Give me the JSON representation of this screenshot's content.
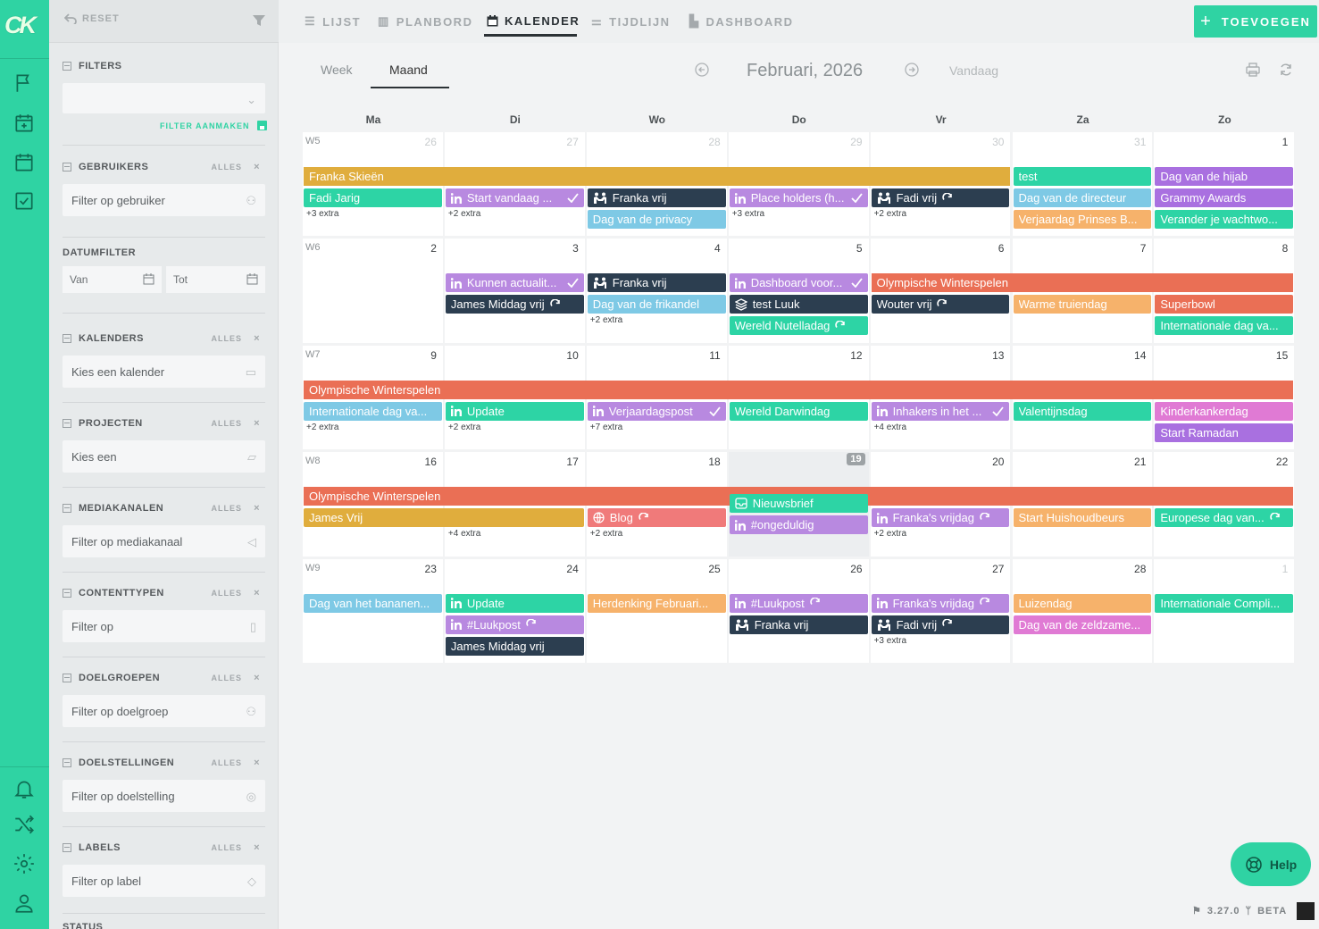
{
  "app": {
    "logo": "CK"
  },
  "sidebar": {
    "reset": "RESET",
    "filters": {
      "label": "FILTERS",
      "select_value": ""
    },
    "filter_aanmaken": "FILTER AANMAKEN",
    "gebruikers": {
      "label": "GEBRUIKERS",
      "alles": "ALLES",
      "placeholder": "Filter op gebruiker"
    },
    "datumfilter": {
      "label": "DATUMFILTER",
      "van": "Van",
      "tot": "Tot"
    },
    "kalenders": {
      "label": "KALENDERS",
      "alles": "ALLES",
      "placeholder": "Kies een kalender"
    },
    "projecten": {
      "label": "PROJECTEN",
      "alles": "ALLES",
      "placeholder": "Kies een"
    },
    "mediakanalen": {
      "label": "MEDIAKANALEN",
      "alles": "ALLES",
      "placeholder": "Filter op mediakanaal"
    },
    "contenttypen": {
      "label": "CONTENTTYPEN",
      "alles": "ALLES",
      "placeholder": "Filter op"
    },
    "doelgroepen": {
      "label": "DOELGROEPEN",
      "alles": "ALLES",
      "placeholder": "Filter op doelgroep"
    },
    "doelstellingen": {
      "label": "DOELSTELLINGEN",
      "alles": "ALLES",
      "placeholder": "Filter op doelstelling"
    },
    "labels": {
      "label": "LABELS",
      "alles": "ALLES",
      "placeholder": "Filter op label"
    },
    "status": {
      "label": "STATUS"
    }
  },
  "nav": {
    "lijst": "LIJST",
    "planbord": "PLANBORD",
    "kalender": "KALENDER",
    "tijdlijn": "TIJDLIJN",
    "dashboard": "DASHBOARD",
    "add": "TOEVOEGEN"
  },
  "calendar": {
    "tabs": {
      "week": "Week",
      "maand": "Maand"
    },
    "month": "Februari, 2026",
    "today": "Vandaag",
    "dows": [
      "Ma",
      "Di",
      "Wo",
      "Do",
      "Vr",
      "Za",
      "Zo"
    ],
    "weeks": [
      {
        "label": "W5",
        "days": [
          "26",
          "27",
          "28",
          "29",
          "30",
          "31",
          "1"
        ],
        "dim": [
          true,
          true,
          true,
          true,
          true,
          true,
          false
        ]
      },
      {
        "label": "W6",
        "days": [
          "2",
          "3",
          "4",
          "5",
          "6",
          "7",
          "8"
        ],
        "dim": [
          false,
          false,
          false,
          false,
          false,
          false,
          false
        ]
      },
      {
        "label": "W7",
        "days": [
          "9",
          "10",
          "11",
          "12",
          "13",
          "14",
          "15"
        ],
        "dim": [
          false,
          false,
          false,
          false,
          false,
          false,
          false
        ]
      },
      {
        "label": "W8",
        "days": [
          "16",
          "17",
          "18",
          "19",
          "20",
          "21",
          "22"
        ],
        "dim": [
          false,
          false,
          false,
          false,
          false,
          false,
          false
        ],
        "today": 3
      },
      {
        "label": "W9",
        "days": [
          "23",
          "24",
          "25",
          "26",
          "27",
          "28",
          "1"
        ],
        "dim": [
          false,
          false,
          false,
          false,
          false,
          false,
          true
        ]
      }
    ],
    "events": [
      {
        "w": 0,
        "d": 0,
        "span": 5,
        "row": 0,
        "title": "Franka Skieën",
        "color": "#e0ad3d"
      },
      {
        "w": 0,
        "d": 5,
        "span": 1,
        "row": 0,
        "title": "test",
        "color": "#2dd4a5"
      },
      {
        "w": 0,
        "d": 6,
        "span": 1,
        "row": 0,
        "title": "Dag van de hijab",
        "color": "#a970e0"
      },
      {
        "w": 0,
        "d": 0,
        "span": 1,
        "row": 1,
        "title": "Fadi Jarig",
        "color": "#2dd4a5"
      },
      {
        "w": 0,
        "d": 1,
        "span": 1,
        "row": 1,
        "title": "Start vandaag ...",
        "color": "#b889e0",
        "icon": "in",
        "status": "check"
      },
      {
        "w": 0,
        "d": 2,
        "span": 1,
        "row": 1,
        "title": "Franka vrij",
        "color": "#2c3e50",
        "icon": "people"
      },
      {
        "w": 0,
        "d": 3,
        "span": 1,
        "row": 1,
        "title": "Place holders (h...",
        "color": "#b889e0",
        "icon": "in",
        "status": "check"
      },
      {
        "w": 0,
        "d": 4,
        "span": 1,
        "row": 1,
        "title": "Fadi vrij",
        "color": "#2c3e50",
        "icon": "people",
        "status": "repeat"
      },
      {
        "w": 0,
        "d": 5,
        "span": 1,
        "row": 1,
        "title": "Dag van de directeur",
        "color": "#7ec9e5"
      },
      {
        "w": 0,
        "d": 6,
        "span": 1,
        "row": 1,
        "title": "Grammy Awards",
        "color": "#a970e0"
      },
      {
        "w": 0,
        "d": 2,
        "span": 1,
        "row": 2,
        "title": "Dag van de privacy",
        "color": "#7ec9e5"
      },
      {
        "w": 0,
        "d": 5,
        "span": 1,
        "row": 2,
        "title": "Verjaardag Prinses B...",
        "color": "#f6b26b"
      },
      {
        "w": 0,
        "d": 6,
        "span": 1,
        "row": 2,
        "title": "Verander je wachtwo...",
        "color": "#2dd4a5"
      },
      {
        "w": 1,
        "d": 4,
        "span": 3,
        "row": 0,
        "title": "Olympische Winterspelen",
        "color": "#ea6f55"
      },
      {
        "w": 1,
        "d": 1,
        "span": 1,
        "row": 0,
        "title": "Kunnen actualit...",
        "color": "#b889e0",
        "icon": "in",
        "status": "check"
      },
      {
        "w": 1,
        "d": 2,
        "span": 1,
        "row": 0,
        "title": "Franka vrij",
        "color": "#2c3e50",
        "icon": "people"
      },
      {
        "w": 1,
        "d": 3,
        "span": 1,
        "row": 0,
        "title": "Dashboard voor...",
        "color": "#b889e0",
        "icon": "in",
        "status": "check"
      },
      {
        "w": 1,
        "d": 1,
        "span": 1,
        "row": 1,
        "title": "James Middag vrij",
        "color": "#2c3e50",
        "status": "repeat"
      },
      {
        "w": 1,
        "d": 2,
        "span": 1,
        "row": 1,
        "title": "Dag van de frikandel",
        "color": "#7ec9e5"
      },
      {
        "w": 1,
        "d": 3,
        "span": 1,
        "row": 1,
        "title": "test Luuk",
        "color": "#2c3e50",
        "icon": "layers"
      },
      {
        "w": 1,
        "d": 4,
        "span": 1,
        "row": 1,
        "title": "Wouter vrij",
        "color": "#2c3e50",
        "status": "repeat"
      },
      {
        "w": 1,
        "d": 5,
        "span": 1,
        "row": 1,
        "title": "Warme truiendag",
        "color": "#f6b26b"
      },
      {
        "w": 1,
        "d": 6,
        "span": 1,
        "row": 1,
        "title": "Superbowl",
        "color": "#ea6f55"
      },
      {
        "w": 1,
        "d": 3,
        "span": 1,
        "row": 2,
        "title": "Wereld Nutelladag",
        "color": "#2dd4a5",
        "status": "repeat"
      },
      {
        "w": 1,
        "d": 6,
        "span": 1,
        "row": 2,
        "title": "Internationale dag va...",
        "color": "#2dd4a5"
      },
      {
        "w": 2,
        "d": 0,
        "span": 7,
        "row": 0,
        "title": "Olympische Winterspelen",
        "color": "#ea6f55"
      },
      {
        "w": 2,
        "d": 0,
        "span": 1,
        "row": 1,
        "title": "Internationale dag va...",
        "color": "#7ec9e5"
      },
      {
        "w": 2,
        "d": 1,
        "span": 1,
        "row": 1,
        "title": "Update",
        "color": "#2dd4a5",
        "icon": "in"
      },
      {
        "w": 2,
        "d": 2,
        "span": 1,
        "row": 1,
        "title": "Verjaardagspost",
        "color": "#b889e0",
        "icon": "in",
        "status": "check"
      },
      {
        "w": 2,
        "d": 3,
        "span": 1,
        "row": 1,
        "title": "Wereld Darwindag",
        "color": "#2dd4a5"
      },
      {
        "w": 2,
        "d": 4,
        "span": 1,
        "row": 1,
        "title": "Inhakers in het ...",
        "color": "#b889e0",
        "icon": "in",
        "status": "check"
      },
      {
        "w": 2,
        "d": 5,
        "span": 1,
        "row": 1,
        "title": "Valentijnsdag",
        "color": "#2dd4a5"
      },
      {
        "w": 2,
        "d": 6,
        "span": 1,
        "row": 1,
        "title": "Kinderkankerdag",
        "color": "#e07ad4"
      },
      {
        "w": 2,
        "d": 6,
        "span": 1,
        "row": 2,
        "title": "Start Ramadan",
        "color": "#a970e0"
      },
      {
        "w": 3,
        "d": 0,
        "span": 7,
        "row": 0,
        "title": "Olympische Winterspelen",
        "color": "#ea6f55"
      },
      {
        "w": 3,
        "d": 0,
        "span": 2,
        "row": 1,
        "title": "James Vrij",
        "color": "#e0ad3d"
      },
      {
        "w": 3,
        "d": 2,
        "span": 1,
        "row": 1,
        "title": "Blog",
        "color": "#f07a7a",
        "icon": "globe",
        "status": "repeat"
      },
      {
        "w": 3,
        "d": 3,
        "span": 1,
        "row": 0.35,
        "title": "Nieuwsbrief",
        "color": "#2dd4a5",
        "icon": "mail"
      },
      {
        "w": 3,
        "d": 3,
        "span": 1,
        "row": 1.35,
        "title": "#ongeduldig",
        "color": "#b889e0",
        "icon": "in"
      },
      {
        "w": 3,
        "d": 4,
        "span": 1,
        "row": 1,
        "title": "Franka's vrijdag",
        "color": "#b889e0",
        "icon": "in",
        "status": "repeat"
      },
      {
        "w": 3,
        "d": 5,
        "span": 1,
        "row": 1,
        "title": "Start Huishoudbeurs",
        "color": "#f6b26b"
      },
      {
        "w": 3,
        "d": 6,
        "span": 1,
        "row": 1,
        "title": "Europese dag van...",
        "color": "#2dd4a5",
        "status": "repeat"
      },
      {
        "w": 4,
        "d": 0,
        "span": 1,
        "row": 0,
        "title": "Dag van het bananen...",
        "color": "#7ec9e5"
      },
      {
        "w": 4,
        "d": 1,
        "span": 1,
        "row": 0,
        "title": "Update",
        "color": "#2dd4a5",
        "icon": "in"
      },
      {
        "w": 4,
        "d": 2,
        "span": 1,
        "row": 0,
        "title": "Herdenking Februari...",
        "color": "#f6b26b"
      },
      {
        "w": 4,
        "d": 3,
        "span": 1,
        "row": 0,
        "title": "#Luukpost",
        "color": "#b889e0",
        "icon": "in",
        "status": "repeat"
      },
      {
        "w": 4,
        "d": 4,
        "span": 1,
        "row": 0,
        "title": "Franka's vrijdag",
        "color": "#b889e0",
        "icon": "in",
        "status": "repeat"
      },
      {
        "w": 4,
        "d": 5,
        "span": 1,
        "row": 0,
        "title": "Luizendag",
        "color": "#f6b26b"
      },
      {
        "w": 4,
        "d": 6,
        "span": 1,
        "row": 0,
        "title": "Internationale Compli...",
        "color": "#2dd4a5"
      },
      {
        "w": 4,
        "d": 1,
        "span": 1,
        "row": 1,
        "title": "#Luukpost",
        "color": "#b889e0",
        "icon": "in",
        "status": "repeat"
      },
      {
        "w": 4,
        "d": 3,
        "span": 1,
        "row": 1,
        "title": "Franka vrij",
        "color": "#2c3e50",
        "icon": "people"
      },
      {
        "w": 4,
        "d": 4,
        "span": 1,
        "row": 1,
        "title": "Fadi vrij",
        "color": "#2c3e50",
        "icon": "people",
        "status": "repeat"
      },
      {
        "w": 4,
        "d": 5,
        "span": 1,
        "row": 1,
        "title": "Dag van de zeldzame...",
        "color": "#e07ad4"
      },
      {
        "w": 4,
        "d": 1,
        "span": 1,
        "row": 2,
        "title": "James Middag vrij",
        "color": "#2c3e50"
      }
    ],
    "extras": [
      {
        "w": 0,
        "d": 0,
        "row": 2,
        "text": "+3 extra"
      },
      {
        "w": 0,
        "d": 1,
        "row": 2,
        "text": "+2 extra"
      },
      {
        "w": 0,
        "d": 3,
        "row": 2,
        "text": "+3 extra"
      },
      {
        "w": 0,
        "d": 4,
        "row": 2,
        "text": "+2 extra"
      },
      {
        "w": 1,
        "d": 2,
        "row": 2,
        "text": "+2 extra"
      },
      {
        "w": 2,
        "d": 0,
        "row": 2,
        "text": "+2 extra"
      },
      {
        "w": 2,
        "d": 1,
        "row": 2,
        "text": "+2 extra"
      },
      {
        "w": 2,
        "d": 2,
        "row": 2,
        "text": "+7 extra"
      },
      {
        "w": 2,
        "d": 4,
        "row": 2,
        "text": "+4 extra"
      },
      {
        "w": 3,
        "d": 1,
        "row": 2,
        "text": "+4 extra"
      },
      {
        "w": 3,
        "d": 2,
        "row": 2,
        "text": "+2 extra"
      },
      {
        "w": 3,
        "d": 4,
        "row": 2,
        "text": "+2 extra"
      },
      {
        "w": 4,
        "d": 4,
        "row": 2,
        "text": "+3 extra"
      }
    ]
  },
  "help": "Help",
  "version": "3.27.0",
  "beta": "BETA"
}
